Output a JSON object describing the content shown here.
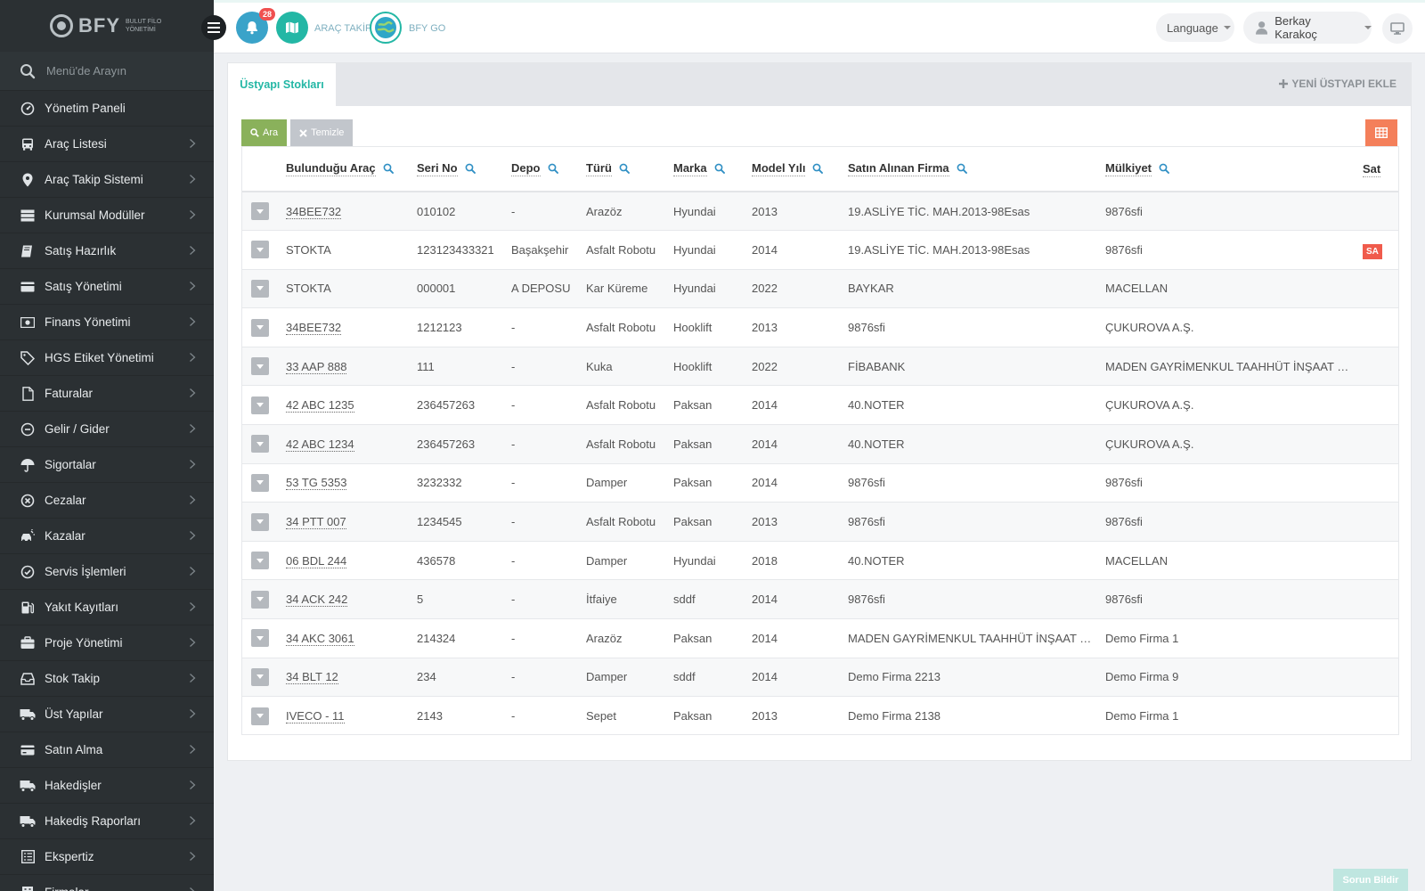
{
  "brand": {
    "name": "BFY",
    "sub_line1": "BULUT FİLO",
    "sub_line2": "YÖNETİMİ"
  },
  "sidebar": {
    "search_placeholder": "Menü'de Arayın",
    "items": [
      {
        "label": "Yönetim Paneli",
        "icon": "dashboard-icon",
        "has_children": false
      },
      {
        "label": "Araç Listesi",
        "icon": "bus-icon",
        "has_children": true
      },
      {
        "label": "Araç Takip Sistemi",
        "icon": "map-pin-icon",
        "has_children": true
      },
      {
        "label": "Kurumsal Modüller",
        "icon": "server-icon",
        "has_children": true
      },
      {
        "label": "Satış Hazırlık",
        "icon": "book-icon",
        "has_children": true
      },
      {
        "label": "Satış Yönetimi",
        "icon": "card-icon",
        "has_children": true
      },
      {
        "label": "Finans Yönetimi",
        "icon": "money-icon",
        "has_children": true
      },
      {
        "label": "HGS Etiket Yönetimi",
        "icon": "tag-icon",
        "has_children": true
      },
      {
        "label": "Faturalar",
        "icon": "file-icon",
        "has_children": true
      },
      {
        "label": "Gelir / Gider",
        "icon": "wallet-icon",
        "has_children": true
      },
      {
        "label": "Sigortalar",
        "icon": "umbrella-icon",
        "has_children": true
      },
      {
        "label": "Cezalar",
        "icon": "times-circle-icon",
        "has_children": true
      },
      {
        "label": "Kazalar",
        "icon": "car-crash-icon",
        "has_children": true
      },
      {
        "label": "Servis İşlemleri",
        "icon": "check-circle-icon",
        "has_children": true
      },
      {
        "label": "Yakıt Kayıtları",
        "icon": "fuel-icon",
        "has_children": true
      },
      {
        "label": "Proje Yönetimi",
        "icon": "briefcase-icon",
        "has_children": true
      },
      {
        "label": "Stok Takip",
        "icon": "inbox-icon",
        "has_children": true
      },
      {
        "label": "Üst Yapılar",
        "icon": "truck-icon",
        "has_children": true
      },
      {
        "label": "Satın Alma",
        "icon": "credit-card-icon",
        "has_children": true
      },
      {
        "label": "Hakedişler",
        "icon": "truck-icon",
        "has_children": true
      },
      {
        "label": "Hakediş Raporları",
        "icon": "truck-icon",
        "has_children": true
      },
      {
        "label": "Ekspertiz",
        "icon": "list-icon",
        "has_children": true
      },
      {
        "label": "Firmalar",
        "icon": "building-icon",
        "has_children": true
      }
    ]
  },
  "topbar": {
    "notifications_count": "28",
    "vehicle_tracking_label": "ARAÇ TAKİP",
    "bfy_go_label": "BFY GO",
    "language_label": "Language",
    "user_name": "Berkay Karakoç"
  },
  "panel": {
    "tab_label": "Üstyapı Stokları",
    "new_button_label": "YENİ ÜSTYAPI EKLE",
    "search_button_label": "Ara",
    "clear_button_label": "Temizle"
  },
  "table": {
    "columns": [
      "Bulunduğu Araç",
      "Seri No",
      "Depo",
      "Türü",
      "Marka",
      "Model Yılı",
      "Satın Alınan Firma",
      "Mülkiyet",
      "Sat"
    ],
    "rows": [
      {
        "vehicle": "34BEE732",
        "vehicle_link": true,
        "serial": "010102",
        "depot": "-",
        "type": "Arazöz",
        "brand": "Hyundai",
        "year": "2013",
        "supplier": "19.ASLİYE TİC. MAH.2013-98Esas",
        "ownership": "9876sfi",
        "status": ""
      },
      {
        "vehicle": "STOKTA",
        "vehicle_link": false,
        "serial": "123123433321",
        "depot": "Başakşehir",
        "type": "Asfalt Robotu",
        "brand": "Hyundai",
        "year": "2014",
        "supplier": "19.ASLİYE TİC. MAH.2013-98Esas",
        "ownership": "9876sfi",
        "status": "SA"
      },
      {
        "vehicle": "STOKTA",
        "vehicle_link": false,
        "serial": "000001",
        "depot": "A DEPOSU",
        "type": "Kar Küreme",
        "brand": "Hyundai",
        "year": "2022",
        "supplier": "BAYKAR",
        "ownership": "MACELLAN",
        "status": ""
      },
      {
        "vehicle": "34BEE732",
        "vehicle_link": true,
        "serial": "1212123",
        "depot": "-",
        "type": "Asfalt Robotu",
        "brand": "Hooklift",
        "year": "2013",
        "supplier": "9876sfi",
        "ownership": "ÇUKUROVA A.Ş.",
        "status": ""
      },
      {
        "vehicle": "33 AAP 888",
        "vehicle_link": true,
        "serial": "111",
        "depot": "-",
        "type": "Kuka",
        "brand": "Hooklift",
        "year": "2022",
        "supplier": "FİBABANK",
        "ownership": "MADEN GAYRİMENKUL TAAHHÜT İNŞAAT SA...",
        "status": ""
      },
      {
        "vehicle": "42 ABC 1235",
        "vehicle_link": true,
        "serial": "236457263",
        "depot": "-",
        "type": "Asfalt Robotu",
        "brand": "Paksan",
        "year": "2014",
        "supplier": "40.NOTER",
        "ownership": "ÇUKUROVA A.Ş.",
        "status": ""
      },
      {
        "vehicle": "42 ABC 1234",
        "vehicle_link": true,
        "serial": "236457263",
        "depot": "-",
        "type": "Asfalt Robotu",
        "brand": "Paksan",
        "year": "2014",
        "supplier": "40.NOTER",
        "ownership": "ÇUKUROVA A.Ş.",
        "status": ""
      },
      {
        "vehicle": "53 TG 5353",
        "vehicle_link": true,
        "serial": "3232332",
        "depot": "-",
        "type": "Damper",
        "brand": "Paksan",
        "year": "2014",
        "supplier": "9876sfi",
        "ownership": "9876sfi",
        "status": ""
      },
      {
        "vehicle": "34 PTT 007",
        "vehicle_link": true,
        "serial": "1234545",
        "depot": "-",
        "type": "Asfalt Robotu",
        "brand": "Paksan",
        "year": "2013",
        "supplier": "9876sfi",
        "ownership": "9876sfi",
        "status": ""
      },
      {
        "vehicle": "06 BDL 244",
        "vehicle_link": true,
        "serial": "436578",
        "depot": "-",
        "type": "Damper",
        "brand": "Hyundai",
        "year": "2018",
        "supplier": "40.NOTER",
        "ownership": "MACELLAN",
        "status": ""
      },
      {
        "vehicle": "34 ACK 242",
        "vehicle_link": true,
        "serial": "5",
        "depot": "-",
        "type": "İtfaiye",
        "brand": "sddf",
        "year": "2014",
        "supplier": "9876sfi",
        "ownership": "9876sfi",
        "status": ""
      },
      {
        "vehicle": "34 AKC 3061",
        "vehicle_link": true,
        "serial": "214324",
        "depot": "-",
        "type": "Arazöz",
        "brand": "Paksan",
        "year": "2014",
        "supplier": "MADEN GAYRİMENKUL TAAHHÜT İNŞAAT SA...",
        "ownership": "Demo Firma 1",
        "status": ""
      },
      {
        "vehicle": "34 BLT 12",
        "vehicle_link": true,
        "serial": "234",
        "depot": "-",
        "type": "Damper",
        "brand": "sddf",
        "year": "2014",
        "supplier": "Demo Firma 2213",
        "ownership": "Demo Firma 9",
        "status": ""
      },
      {
        "vehicle": "IVECO - 11",
        "vehicle_link": true,
        "serial": "2143",
        "depot": "-",
        "type": "Sepet",
        "brand": "Paksan",
        "year": "2013",
        "supplier": "Demo Firma 2138",
        "ownership": "Demo Firma 1",
        "status": ""
      }
    ]
  },
  "footer": {
    "report_button_label": "Sorun Bildir"
  },
  "colors": {
    "accent": "#23b7a5",
    "sidebar_bg": "#2b3033",
    "search_btn": "#8ab15b",
    "grid_btn": "#f47f5a",
    "badge": "#f05050"
  }
}
